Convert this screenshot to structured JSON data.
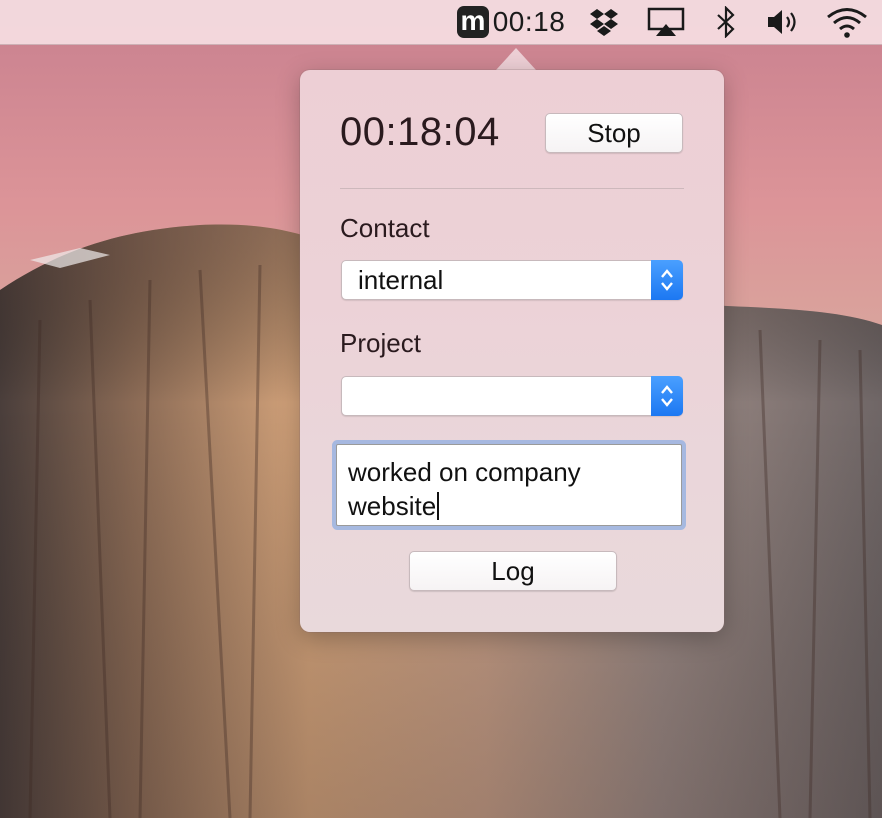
{
  "menubar": {
    "app_icon_letter": "m",
    "timer_text": "00:18",
    "icons": [
      "dropbox-icon",
      "airplay-icon",
      "bluetooth-icon",
      "volume-icon",
      "wifi-icon"
    ]
  },
  "popover": {
    "elapsed_time": "00:18:04",
    "stop_label": "Stop",
    "contact": {
      "label": "Contact",
      "selected": "internal"
    },
    "project": {
      "label": "Project",
      "selected": ""
    },
    "notes": {
      "line1": "worked on company",
      "line2": "website"
    },
    "log_label": "Log"
  },
  "colors": {
    "accent": "#1c78f2",
    "focus_ring": "#6ea0e6"
  }
}
